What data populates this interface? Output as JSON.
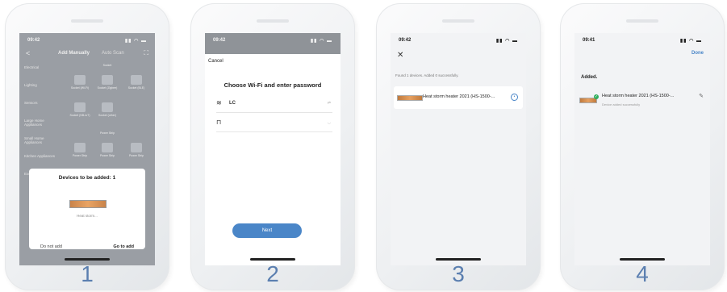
{
  "steps": [
    {
      "number": "1",
      "status": {
        "time": "09:42",
        "signal": "▮▮ ◠ ▬"
      },
      "nav": {
        "back": "<",
        "title": "Add Manually",
        "alt_tab": "Auto Scan",
        "scan": "⛶"
      },
      "sidebar": [
        "Electrical",
        "Lighting",
        "Sensors",
        "Large Home Appliances",
        "Small Home Appliances",
        "Kitchen Appliances",
        "Exercise & Health"
      ],
      "grid_labels": [
        "Socket (Wi-Fi)",
        "Socket (Zigbee)",
        "Socket (BLE)",
        "Socket (NB-IoT)",
        "Socket (other)",
        "Power Strip",
        "Power Strip",
        "Power Strip"
      ],
      "section_labels": [
        "Socket",
        "Power Strip"
      ],
      "dialog": {
        "title": "Devices to be added: 1",
        "device_name": "Heat storm...",
        "cancel": "Do not add",
        "confirm": "Go to add"
      }
    },
    {
      "number": "2",
      "status": {
        "time": "09:42",
        "signal": "▮▮ ◠ ▬"
      },
      "cancel": "Cancel",
      "title": "Choose Wi-Fi and enter password",
      "wifi": {
        "name": "LC",
        "aux": "⇄"
      },
      "password": {
        "value": "",
        "aux": "◡"
      },
      "next": "Next"
    },
    {
      "number": "3",
      "status": {
        "time": "09:42",
        "signal": "▮▮ ◠ ▬"
      },
      "close": "✕",
      "found": "Found 1 devices. Added 0 successfully.",
      "device": "Heat storm heater 2021 (HS-1500-...",
      "selector": "•"
    },
    {
      "number": "4",
      "status": {
        "time": "09:41",
        "signal": "▮▮ ◠ ▬"
      },
      "done": "Done",
      "added": "Added.",
      "device": "Heat storm heater 2021 (HS-1500-...",
      "sub": "Device added successfully",
      "edit": "✎",
      "check": "✓"
    }
  ],
  "colors": {
    "number": "#5b7fb0",
    "accent": "#4a86c8",
    "success": "#2fae5c"
  }
}
